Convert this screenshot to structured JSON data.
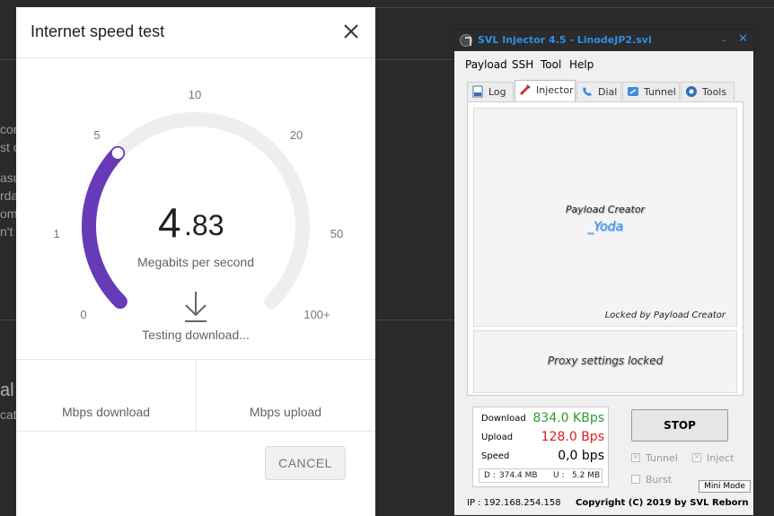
{
  "background": {
    "fragments": [
      "com",
      "st c",
      "asu",
      "rda",
      "om",
      "n't",
      "al",
      "cat"
    ]
  },
  "speed_dialog": {
    "title": "Internet speed test",
    "gauge": {
      "ticks": [
        "0",
        "1",
        "5",
        "10",
        "20",
        "50",
        "100+"
      ],
      "value_mbps": 4.83,
      "accent_color": "#673ab7",
      "track_color": "#eeeeee"
    },
    "speed_integer": "4",
    "speed_decimal": ".83",
    "unit": "Megabits per second",
    "status": "Testing download...",
    "download_label": "Mbps download",
    "upload_label": "Mbps upload",
    "cancel_label": "CANCEL"
  },
  "injector": {
    "title": "SVL Injector 4.5 - LinodeJP2.svi",
    "minimize": "–",
    "close": "✕",
    "menu": [
      "Payload",
      "SSH",
      "Tool",
      "Help"
    ],
    "tabs": [
      {
        "label": "Log",
        "icon": "log-icon"
      },
      {
        "label": "Injector",
        "icon": "syringe-icon"
      },
      {
        "label": "Dial",
        "icon": "phone-icon"
      },
      {
        "label": "Tunnel",
        "icon": "tunnel-icon"
      },
      {
        "label": "Tools",
        "icon": "tools-icon"
      }
    ],
    "active_tab": "Injector",
    "payload_creator_title": "Payload Creator",
    "payload_creator_name": "_Yoda",
    "locked_by": "Locked by Payload Creator",
    "proxy_locked": "Proxy settings locked",
    "stats": {
      "download_label": "Download",
      "download_value": "834.0 KBps",
      "upload_label": "Upload",
      "upload_value": "128.0 Bps",
      "speed_label": "Speed",
      "speed_value": "0,0 bps",
      "d_label": "D :",
      "d_value": "374.4 MB",
      "u_label": "U :",
      "u_value": "5.2 MB"
    },
    "colors": {
      "download": "#2e9a2e",
      "upload": "#d9201c",
      "title": "#2f8fe6"
    },
    "stop_label": "STOP",
    "checkboxes": [
      {
        "label": "Tunnel",
        "checked": true
      },
      {
        "label": "Inject",
        "checked": true
      },
      {
        "label": "Burst",
        "checked": false
      }
    ],
    "mini_mode_label": "Mini Mode",
    "ip_label": "IP : 192.168.254.158",
    "copyright": "Copyright (C) 2019 by SVL Reborn"
  }
}
